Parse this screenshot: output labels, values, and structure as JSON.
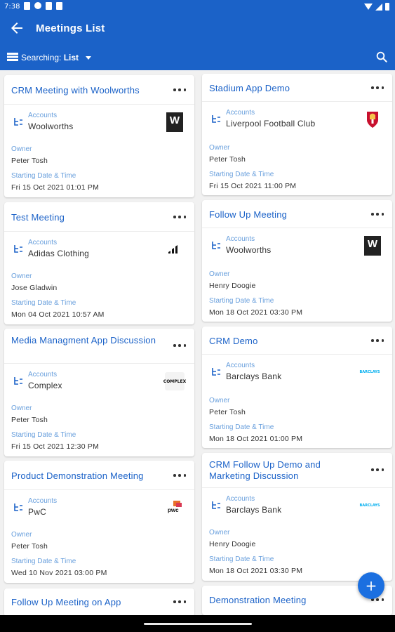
{
  "statusbar": {
    "time": "7:38"
  },
  "header": {
    "title": "Meetings List"
  },
  "subbar": {
    "searching_label": "Searching:",
    "searching_value": "List"
  },
  "labels": {
    "accounts": "Accounts",
    "owner": "Owner",
    "starting": "Starting Date & Time"
  },
  "left": [
    {
      "title": "CRM Meeting with Woolworths",
      "account": "Woolworths",
      "logo": "woolworths-logo",
      "owner": "Peter Tosh",
      "date": "Fri 15 Oct 2021 01:01 PM"
    },
    {
      "title": "Test Meeting",
      "account": "Adidas Clothing",
      "logo": "adidas-logo",
      "owner": "Jose Gladwin",
      "date": "Mon 04 Oct 2021 10:57 AM"
    },
    {
      "title": "Media Managment App Discussion",
      "account": "Complex",
      "logo": "complex-logo",
      "owner": "Peter Tosh",
      "date": "Fri 15 Oct 2021 12:30 PM"
    },
    {
      "title": "Product Demonstration Meeting",
      "account": "PwC",
      "logo": "pwc-logo",
      "owner": "Peter Tosh",
      "date": "Wed 10 Nov 2021 03:00 PM"
    },
    {
      "title": "Follow Up Meeting on App"
    }
  ],
  "right": [
    {
      "title": "Stadium App Demo",
      "account": "Liverpool Football Club",
      "logo": "liverpool-logo",
      "owner": "Peter Tosh",
      "date": "Fri 15 Oct 2021 11:00 PM"
    },
    {
      "title": "Follow Up Meeting",
      "account": "Woolworths",
      "logo": "woolworths-logo",
      "owner": "Henry Doogie",
      "date": "Mon 18 Oct 2021 03:30 PM"
    },
    {
      "title": "CRM Demo",
      "account": "Barclays Bank",
      "logo": "barclays-logo",
      "owner": "Peter Tosh",
      "date": "Mon 18 Oct 2021 01:00 PM"
    },
    {
      "title": "CRM Follow Up Demo and Marketing Discussion",
      "account": "Barclays Bank",
      "logo": "barclays-logo",
      "owner": "Henry Doogie",
      "date": "Mon 18 Oct 2021 03:30 PM"
    },
    {
      "title": "Demonstration Meeting"
    }
  ],
  "logos": {
    "woolworths": "W",
    "adidas": "adidas",
    "complex": "COMPLEX",
    "pwc": "pwc",
    "barclays": "BARCLAYS"
  },
  "colors": {
    "primary": "#1b62c8",
    "accent_label": "#6aa0dd",
    "fab": "#1b6fe0"
  },
  "fab": {
    "icon": "plus-icon",
    "label": "+"
  }
}
